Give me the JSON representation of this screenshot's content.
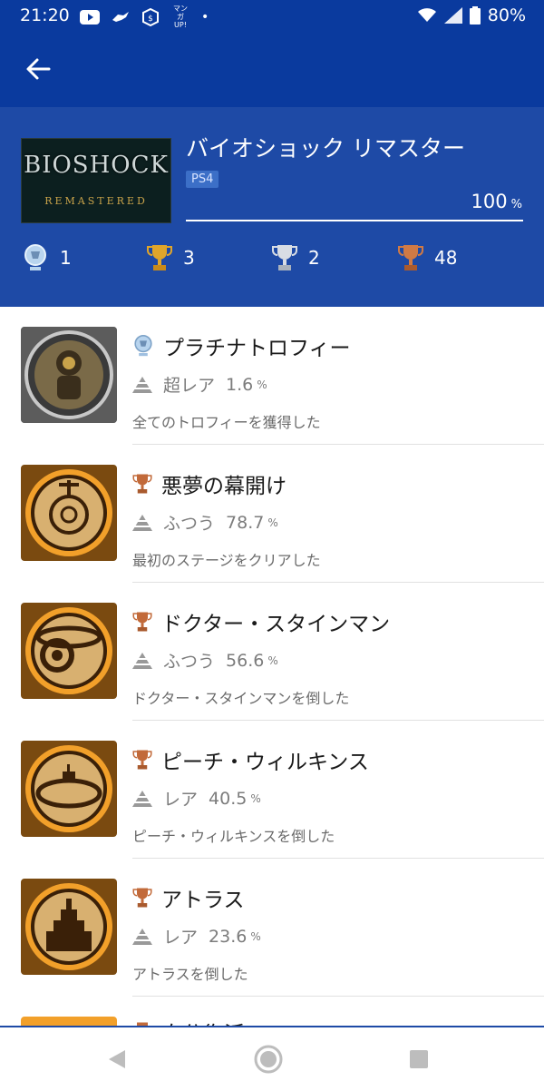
{
  "status_bar": {
    "time": "21:20",
    "battery": "80%",
    "left_icons": [
      "youtube-icon",
      "bird-icon",
      "app-icon",
      "manga-up-icon",
      "dot-icon"
    ],
    "manga_up_label": "マンガ UP!",
    "right_icons": [
      "wifi-icon",
      "signal-icon",
      "battery-icon"
    ]
  },
  "app_bar": {
    "back_icon": "arrow-left-icon"
  },
  "game": {
    "cover_logo": "BIOSHOCK",
    "cover_sub": "REMASTERED",
    "title": "バイオショック リマスター",
    "platform": "PS4",
    "progress_value": "100",
    "progress_unit": "%",
    "progress_fraction": 1.0
  },
  "trophy_counts": [
    {
      "type": "platinum",
      "count": "1",
      "color": "#9fc4e8"
    },
    {
      "type": "gold",
      "count": "3",
      "color": "#e0a52a"
    },
    {
      "type": "silver",
      "count": "2",
      "color": "#c9ced6"
    },
    {
      "type": "bronze",
      "count": "48",
      "color": "#c26a3a"
    }
  ],
  "trophies": [
    {
      "name": "プラチナトロフィー",
      "type": "platinum",
      "rarity": "超レア",
      "percent": "1.6",
      "unit": "%",
      "desc": "全てのトロフィーを獲得した",
      "image": "big-daddy-image"
    },
    {
      "name": "悪夢の幕開け",
      "type": "bronze",
      "rarity": "ふつう",
      "percent": "78.7",
      "unit": "%",
      "desc": "最初のステージをクリアした",
      "image": "bathysphere-image"
    },
    {
      "name": "ドクター・スタインマン",
      "type": "bronze",
      "rarity": "ふつう",
      "percent": "56.6",
      "unit": "%",
      "desc": "ドクター・スタインマンを倒した",
      "image": "ring-image"
    },
    {
      "name": "ピーチ・ウィルキンス",
      "type": "bronze",
      "rarity": "レア",
      "percent": "40.5",
      "unit": "%",
      "desc": "ピーチ・ウィルキンスを倒した",
      "image": "submarine-image"
    },
    {
      "name": "アトラス",
      "type": "bronze",
      "rarity": "レア",
      "percent": "23.6",
      "unit": "%",
      "desc": "アトラスを倒した",
      "image": "city-image"
    }
  ],
  "partial_row": {
    "type": "bronze",
    "name_partial": "自分復活"
  },
  "nav_bar": {
    "back": "nav-back-icon",
    "home": "nav-home-icon",
    "recents": "nav-recents-icon"
  },
  "colors": {
    "header_dark": "#0a3a9e",
    "header": "#1e4aa6",
    "bronze": "#c26a3a",
    "rarity_gray": "#7c7c7c"
  }
}
